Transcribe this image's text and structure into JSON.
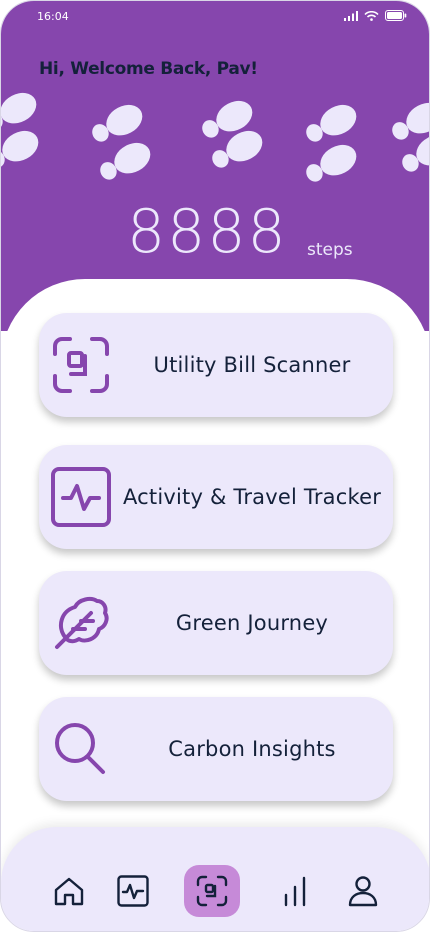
{
  "status_bar": {
    "time": "16:04",
    "icons": [
      "signal-icon",
      "wifi-icon",
      "battery-icon"
    ]
  },
  "header": {
    "greeting": "Hi, Welcome Back, Pav!",
    "steps_count": "8888",
    "steps_unit": "steps",
    "background_color": "#8646ad",
    "decoration": "footprints"
  },
  "cards": [
    {
      "label": "Utility Bill Scanner",
      "icon": "scan-icon"
    },
    {
      "label": "Activity & Travel Tracker",
      "icon": "activity-icon"
    },
    {
      "label": "Green Journey",
      "icon": "leaf-icon"
    },
    {
      "label": "Carbon Insights",
      "icon": "search-icon"
    }
  ],
  "bottom_nav": {
    "items": [
      {
        "icon": "home-icon",
        "active": false
      },
      {
        "icon": "activity-icon",
        "active": false
      },
      {
        "icon": "scan-icon",
        "active": true
      },
      {
        "icon": "bar-chart-icon",
        "active": false
      },
      {
        "icon": "user-icon",
        "active": false
      }
    ]
  },
  "colors": {
    "primary": "#8646ad",
    "card_background": "#ece8fb",
    "accent_icon": "#8646ad",
    "active_nav": "#c68ad8",
    "text_dark": "#14213a"
  }
}
